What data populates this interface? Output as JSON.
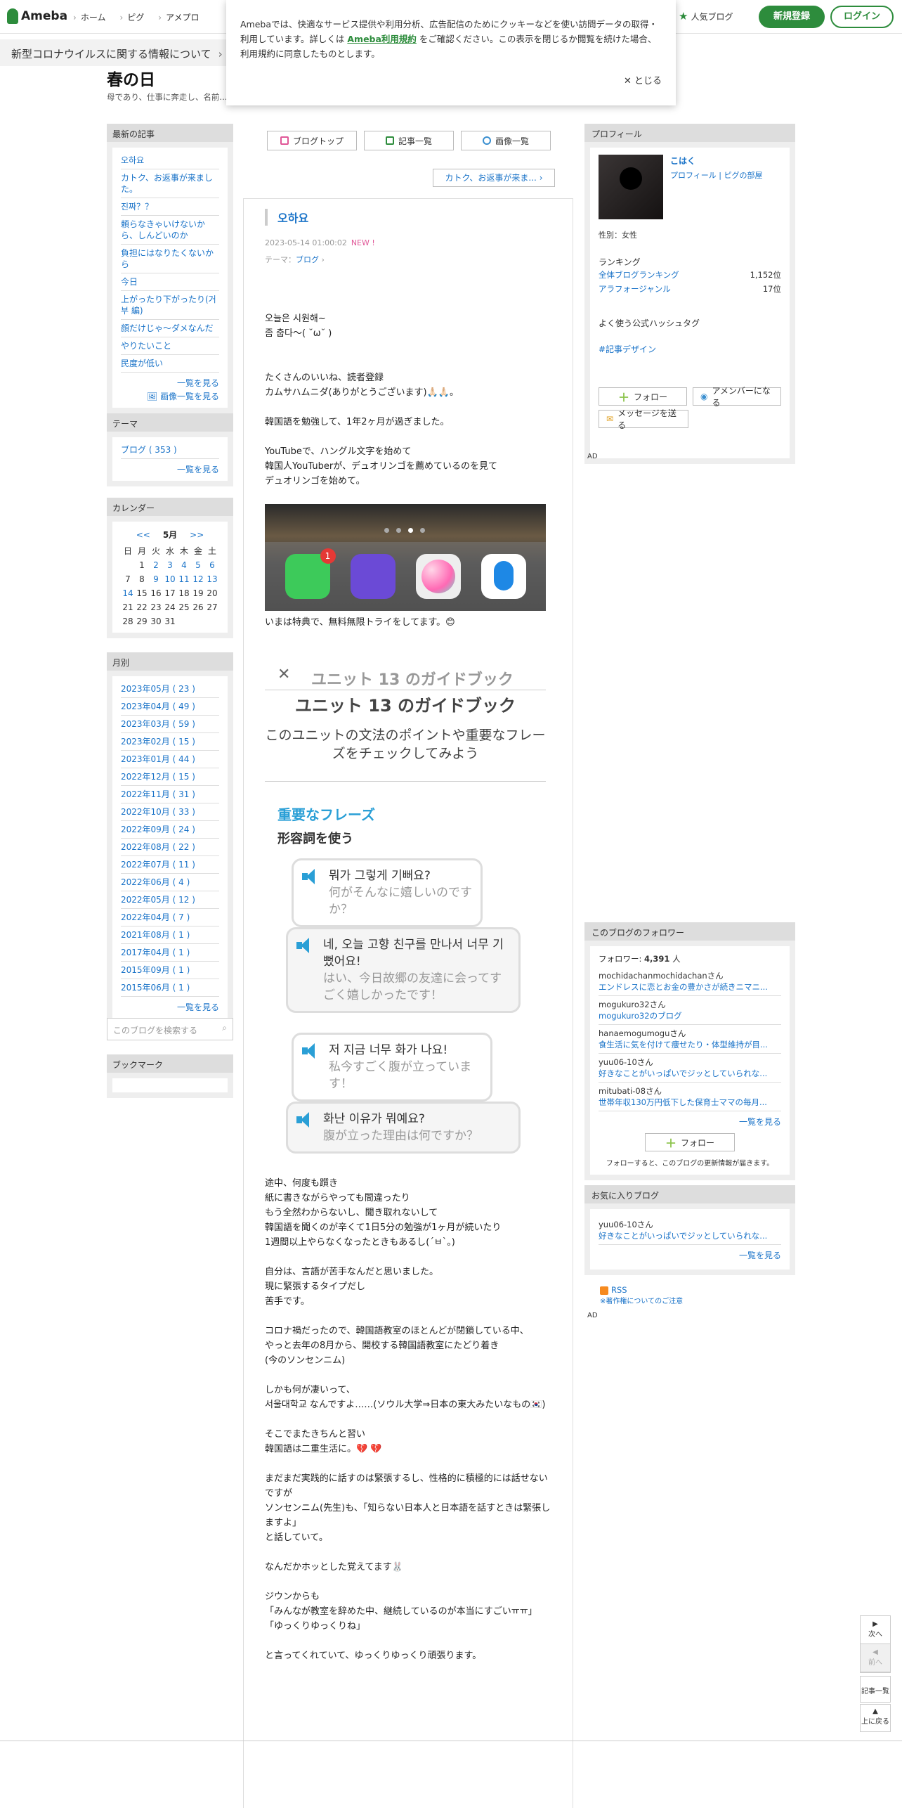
{
  "header": {
    "logo": "Ameba",
    "nav": [
      "ホーム",
      "ピグ",
      "アメプロ"
    ],
    "popular_blog": "人気ブログ",
    "register": "新規登録",
    "login": "ログイン"
  },
  "covid_banner": "新型コロナウイルスに関する情報について",
  "cookie": {
    "text_before": "Amebaでは、快適なサービス提供や利用分析、広告配信のためにクッキーなどを使い訪問データの取得・利用しています。詳しくは",
    "link": "Ameba利用規約",
    "text_after": "をご確認ください。この表示を閉じるか閲覧を続けた場合、利用規約に同意したものとします。",
    "close": "とじる"
  },
  "blog": {
    "title": "春の日",
    "description": "母であり、仕事に奔走し、名前..."
  },
  "left": {
    "recent_head": "最新の記事",
    "recent": [
      "오하요",
      "カトク、お返事が来ました。",
      "진짜？？",
      "頼らなきゃいけないから、しんどいのか",
      "負担にはなりたくないから",
      "今日",
      "上がったり下がったり(거부 編)",
      "顔だけじゃ〜ダメなんだ",
      "やりたいこと",
      "民度が低い"
    ],
    "more": "一覧を見る",
    "image_more": "画像一覧を見る",
    "theme_head": "テーマ",
    "theme_item": "ブログ ( 353 )",
    "calendar_head": "カレンダー",
    "calendar_prev": "<<",
    "calendar_month": "5月",
    "calendar_next": ">>",
    "calendar_days": [
      "日",
      "月",
      "火",
      "水",
      "木",
      "金",
      "土"
    ],
    "calendar_rows": [
      [
        "",
        "1",
        "2",
        "3",
        "4",
        "5",
        "6"
      ],
      [
        "7",
        "8",
        "9",
        "10",
        "11",
        "12",
        "13"
      ],
      [
        "14",
        "15",
        "16",
        "17",
        "18",
        "19",
        "20"
      ],
      [
        "21",
        "22",
        "23",
        "24",
        "25",
        "26",
        "27"
      ],
      [
        "28",
        "29",
        "30",
        "31",
        "",
        "",
        ""
      ]
    ],
    "calendar_links": [
      "2",
      "3",
      "4",
      "5",
      "6",
      "9",
      "10",
      "11",
      "12",
      "13",
      "14"
    ],
    "monthly_head": "月別",
    "monthly": [
      "2023年05月 ( 23 )",
      "2023年04月 ( 49 )",
      "2023年03月 ( 59 )",
      "2023年02月 ( 15 )",
      "2023年01月 ( 44 )",
      "2022年12月 ( 15 )",
      "2022年11月 ( 31 )",
      "2022年10月 ( 33 )",
      "2022年09月 ( 24 )",
      "2022年08月 ( 22 )",
      "2022年07月 ( 11 )",
      "2022年06月 ( 4 )",
      "2022年05月 ( 12 )",
      "2022年04月 ( 7 )",
      "2021年08月 ( 1 )",
      "2017年04月 ( 1 )",
      "2015年09月 ( 1 )",
      "2015年06月 ( 1 )"
    ],
    "search_placeholder": "このブログを検索する",
    "bookmark_head": "ブックマーク"
  },
  "center": {
    "tabs": [
      "ブログトップ",
      "記事一覧",
      "画像一覧"
    ],
    "prev_article": "カトク、お返事が来ま...",
    "article_title": "오하요",
    "date": "2023-05-14 01:00:02",
    "new_label": "NEW !",
    "theme_prefix": "テーマ：",
    "theme_link": "ブログ",
    "body1": [
      "오늘은 시원해~",
      "좀 춥다〜( ˘ω˘ )",
      "",
      "",
      "たくさんのいいね、読者登録",
      "カムサハムニダ(ありがとうございます)🙏🏻🙏🏻。",
      "",
      "韓国語を勉強して、1年2ヶ月が過ぎました。",
      "",
      "YouTubeで、ハングル文字を始めて",
      "韓国人YouTuberが、デュオリンゴを薦めているのを見て",
      "デュオリンゴを始めて。"
    ],
    "phone_badge": "1",
    "caption": "いまは特典で、無料無限トライをしてます。😊",
    "guide": {
      "x": "✕",
      "title_faded": "ユニット 13 のガイドブック",
      "title": "ユニット 13 のガイドブック",
      "subtitle": "このユニットの文法のポイントや重要なフレーズをチェックしてみよう",
      "section": "重要なフレーズ",
      "subsection": "形容詞を使う",
      "phrases": [
        {
          "ko": "뭐가 그렇게 기뻐요?",
          "jp": "何がそんなに嬉しいのですか？"
        },
        {
          "ko": "네, 오늘 고향 친구를 만나서 너무 기뻤어요!",
          "jp": "はい、今日故郷の友達に会ってすごく嬉しかったです！"
        },
        {
          "ko": "저 지금 너무 화가 나요!",
          "jp": "私今すごく腹が立っています！"
        },
        {
          "ko": "화난 이유가 뭐예요?",
          "jp": "腹が立った理由は何ですか？"
        }
      ]
    },
    "body2": [
      "途中、何度も躓き",
      "紙に書きながらやっても間違ったり",
      "もう全然わからないし、聞き取れないして",
      "韓国語を聞くのが辛くて1日5分の勉強が1ヶ月が続いたり",
      "1週間以上やらなくなったときもあるし(´ㅂ`。)",
      "",
      "自分は、言語が苦手なんだと思いました。",
      "現に緊張するタイプだし",
      "苦手です。",
      "",
      "コロナ禍だったので、韓国語教室のほとんどが閉鎖している中、",
      "やっと去年の8月から、開校する韓国語教室にたどり着き",
      "(今のソンセンニム)",
      "",
      "しかも何が凄いって、",
      "서울대학교 なんですよ……(ソウル大学⇒日本の東大みたいなもの🇰🇷)",
      "",
      "そこでまたきちんと習い",
      "韓国語は二重生活に。💔 💔",
      "",
      "まだまだ実践的に話すのは緊張するし、性格的に積極的には話せないですが",
      "ソンセンニム(先生)も、「知らない日本人と日本語を話すときは緊張しますよ」",
      "と話していて。",
      "",
      "なんだかホッとした覚えてます🐰",
      "",
      "ジウンからも",
      "「みんなが教室を辞めた中、継続しているのが本当にすごいㅠㅠ」",
      "「ゆっくりゆっくりね」",
      "",
      "と言ってくれていて、ゆっくりゆっくり頑張ります。"
    ]
  },
  "right": {
    "profile_head": "プロフィール",
    "name": "こはく",
    "profile_link": "プロフィール",
    "pig_link": "ピグの部屋",
    "gender": "性別：女性",
    "ranking_head": "ランキング",
    "ranking": [
      {
        "label": "全体ブログランキング",
        "value": "1,152位"
      },
      {
        "label": "アラフォージャンル",
        "value": "17位"
      }
    ],
    "hashtag_head": "よく使う公式ハッシュタグ",
    "hashtag": "#記事デザイン",
    "follow": "フォロー",
    "member": "アメンバーになる",
    "message": "メッセージを送る",
    "ad": "AD",
    "followers_head": "このブログのフォロワー",
    "followers_label": "フォロワー:",
    "followers_count": "4,391",
    "followers_unit": "人",
    "followers": [
      {
        "user": "mochidachanmochidachanさん",
        "blog": "エンドレスに恋とお金の豊かさが続きニマニ..."
      },
      {
        "user": "mogukuro32さん",
        "blog": "mogukuro32のブログ"
      },
      {
        "user": "hanaemogumoguさん",
        "blog": "食生活に気を付けて痩せたり・体型維持が目..."
      },
      {
        "user": "yuu06-10さん",
        "blog": "好きなことがいっぱいでジッとしていられな..."
      },
      {
        "user": "mitubati-08さん",
        "blog": "世帯年収130万円低下した保育士ママの毎月..."
      }
    ],
    "followers_more": "一覧を見る",
    "follow_note": "フォローすると、このブログの更新情報が届きます。",
    "fav_head": "お気に入りブログ",
    "fav_user": "yuu06-10さん",
    "fav_blog": "好きなことがいっぱいでジッとしていられな...",
    "fav_more": "一覧を見る",
    "rss": "RSS",
    "copyright": "※著作権についてのご注意"
  },
  "sidenav": {
    "next": "次へ",
    "prev": "前へ",
    "list": "記事一覧",
    "top": "上に戻る"
  }
}
